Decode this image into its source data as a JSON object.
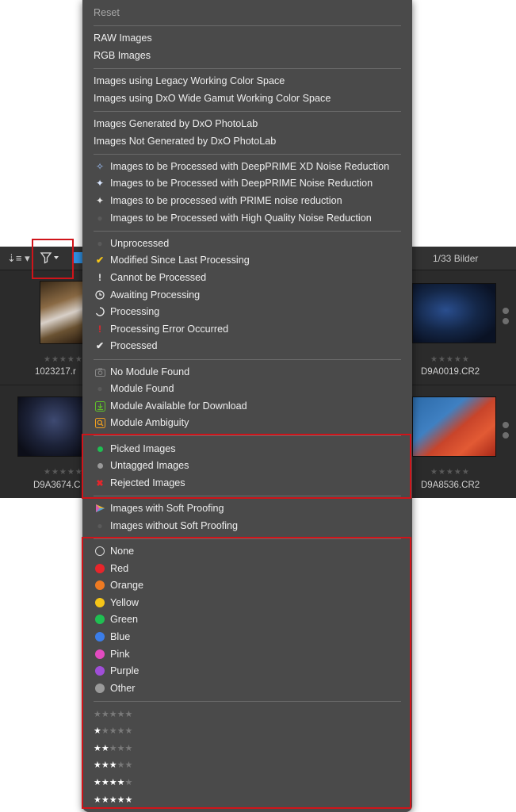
{
  "filmstrip": {
    "image_count": "1/33 Bilder",
    "row1": [
      {
        "name": "1023217.r",
        "stars": "★★★★★"
      },
      {
        "name": "D9A0019.CR2",
        "stars": "★★★★★"
      }
    ],
    "row2": [
      {
        "name": "D9A3674.C",
        "stars": "★★★★★"
      },
      {
        "name": "D9A8536.CR2",
        "stars": "★★★★★"
      }
    ]
  },
  "menu": {
    "reset": "Reset",
    "file_types": [
      "RAW Images",
      "RGB Images"
    ],
    "color_space": [
      "Images using Legacy Working Color Space",
      "Images using DxO Wide Gamut Working Color Space"
    ],
    "generated": [
      "Images Generated by DxO PhotoLab",
      "Images Not Generated by DxO PhotoLab"
    ],
    "noise": [
      "Images to be Processed with DeepPRIME XD Noise Reduction",
      "Images to be Processed with DeepPRIME Noise Reduction",
      "Images to be processed with PRIME noise reduction",
      "Images to be Processed with High Quality Noise Reduction"
    ],
    "processing": [
      "Unprocessed",
      "Modified Since Last Processing",
      "Cannot be Processed",
      "Awaiting Processing",
      "Processing",
      "Processing Error Occurred",
      "Processed"
    ],
    "modules": [
      "No Module Found",
      "Module Found",
      "Module Available for Download",
      "Module Ambiguity"
    ],
    "tags": [
      "Picked Images",
      "Untagged Images",
      "Rejected Images"
    ],
    "proofing": [
      "Images with Soft Proofing",
      "Images without Soft Proofing"
    ],
    "colors": [
      {
        "label": "None",
        "color": "none"
      },
      {
        "label": "Red",
        "color": "#e8252b"
      },
      {
        "label": "Orange",
        "color": "#ee7a22"
      },
      {
        "label": "Yellow",
        "color": "#f5c518"
      },
      {
        "label": "Green",
        "color": "#1fbf52"
      },
      {
        "label": "Blue",
        "color": "#3b7de8"
      },
      {
        "label": "Pink",
        "color": "#e24bc0"
      },
      {
        "label": "Purple",
        "color": "#a04ed8"
      },
      {
        "label": "Other",
        "color": "#9a9a9a"
      }
    ],
    "ratings": [
      0,
      1,
      2,
      3,
      4,
      5
    ]
  }
}
